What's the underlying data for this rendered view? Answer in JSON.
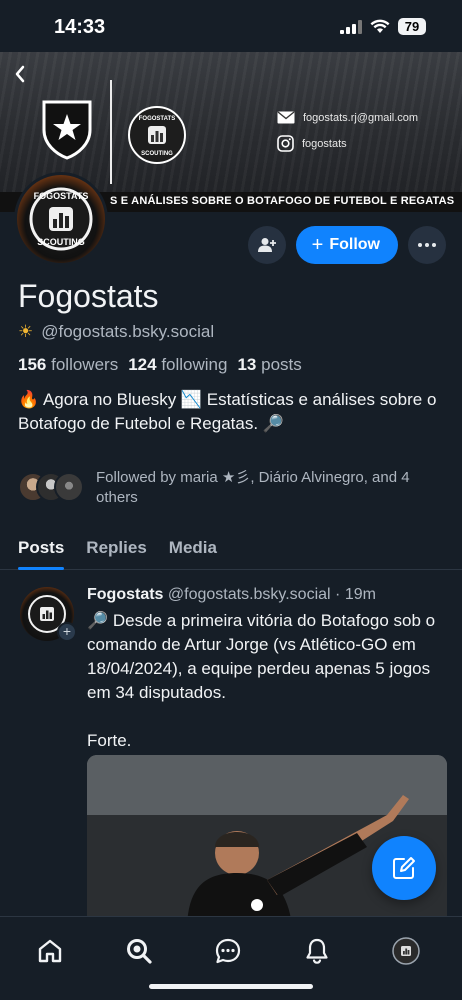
{
  "status_bar": {
    "time": "14:33",
    "battery": "79"
  },
  "banner": {
    "email": "fogostats.rj@gmail.com",
    "instagram": "fogostats",
    "tagline": "S E ANÁLISES SOBRE O BOTAFOGO DE FUTEBOL E REGATAS",
    "logo_text_top": "FOGOSTATS",
    "logo_text_bottom": "SCOUTING"
  },
  "profile": {
    "display_name": "Fogostats",
    "handle_emoji": "☀",
    "handle": "@fogostats.bsky.social",
    "followers_count": "156",
    "followers_label": "followers",
    "following_count": "124",
    "following_label": "following",
    "posts_count": "13",
    "posts_label": "posts",
    "bio": "🔥 Agora no Bluesky 📉 Estatísticas e análises sobre o Botafogo de Futebol e Regatas. 🔎",
    "followed_by": "Followed by maria ★彡, Diário Alvinegro, and 4 others",
    "follow_label": "Follow"
  },
  "tabs": [
    {
      "label": "Posts",
      "active": true
    },
    {
      "label": "Replies",
      "active": false
    },
    {
      "label": "Media",
      "active": false
    }
  ],
  "post": {
    "author": "Fogostats",
    "handle": "@fogostats.bsky.social",
    "separator": " · ",
    "time": "19m",
    "text": "🔎 Desde a primeira vitória do Botafogo sob o comando de Artur Jorge (vs Atlético-GO em 18/04/2024), a equipe perdeu apenas 5 jogos em 34 disputados.\n\nForte."
  },
  "colors": {
    "background": "#161e27",
    "accent": "#1083fe",
    "muted_text": "#aeb6c0"
  },
  "nav": [
    "home-icon",
    "search-icon",
    "chat-icon",
    "bell-icon",
    "profile-avatar"
  ]
}
